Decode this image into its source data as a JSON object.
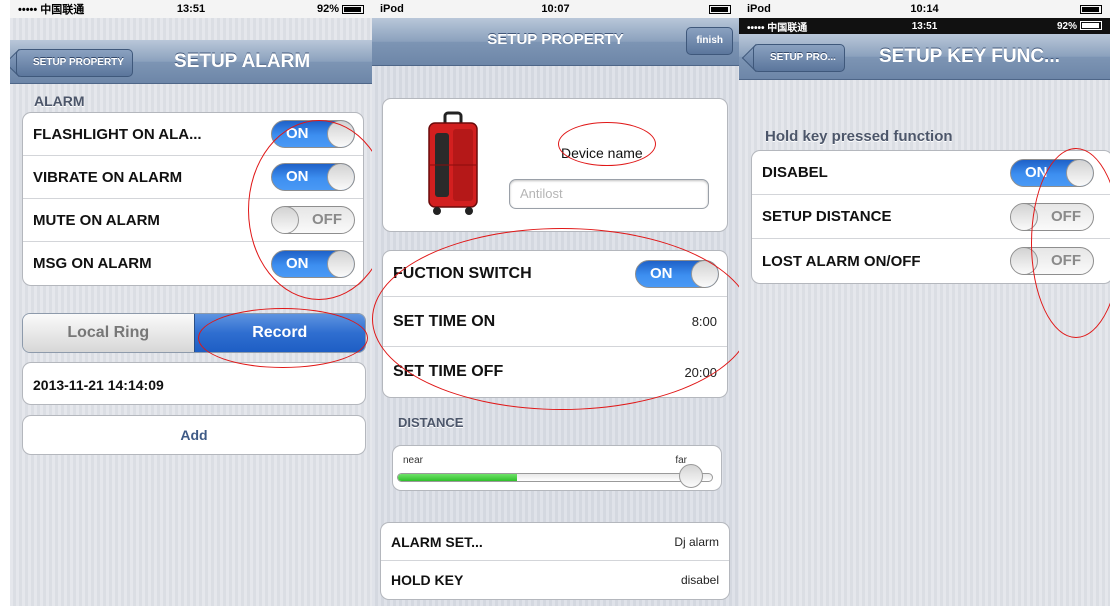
{
  "colors": {
    "toggle_on": "#3d8ff0",
    "annotation": "#e01717",
    "navbar": "#7d95b4",
    "slider_fill": "#2fc02b"
  },
  "screen1": {
    "status": {
      "carrier": "••••• 中国联通 ",
      "time": "13:51",
      "battery": "92%"
    },
    "back_label": "SETUP PROPERTY",
    "title": "SETUP ALARM",
    "section": "ALARM",
    "toggles": [
      {
        "label": "FLASHLIGHT ON ALA...",
        "state": "ON"
      },
      {
        "label": "VIBRATE ON ALARM",
        "state": "ON"
      },
      {
        "label": "MUTE ON ALARM",
        "state": "OFF"
      },
      {
        "label": "MSG ON ALARM",
        "state": "ON"
      }
    ],
    "segments": {
      "left": "Local Ring",
      "right": "Record",
      "selected": "Record"
    },
    "record_entry": "2013-11-21 14:14:09",
    "add_label": "Add"
  },
  "screen2": {
    "status": {
      "device": "iPod",
      "time": "10:07"
    },
    "title": "SETUP PROPERTY",
    "finish_label": "finish",
    "device_name_label": "Device name",
    "device_name_placeholder": "Antilost",
    "switch_row": {
      "label": "FUCTION SWITCH",
      "state": "ON"
    },
    "time_rows": [
      {
        "label": "SET TIME ON",
        "value": "8:00"
      },
      {
        "label": "SET TIME OFF",
        "value": "20:00"
      }
    ],
    "distance_section": "DISTANCE",
    "slider": {
      "min_label": "near",
      "max_label": "far",
      "fill_fraction": 0.38
    },
    "bottom_rows": [
      {
        "label": "ALARM SET...",
        "value": "Dj alarm"
      },
      {
        "label": "HOLD KEY",
        "value": "disabel"
      }
    ]
  },
  "screen3": {
    "outer_status": {
      "device": "iPod",
      "time": "10:14"
    },
    "status": {
      "carrier": "••••• 中国联通 ",
      "time": "13:51",
      "battery": "92%"
    },
    "back_label": "SETUP PRO...",
    "title": "SETUP KEY FUNC...",
    "section": "Hold key pressed function",
    "toggles": [
      {
        "label": "DISABEL",
        "state": "ON"
      },
      {
        "label": "SETUP DISTANCE",
        "state": "OFF"
      },
      {
        "label": "LOST ALARM ON/OFF",
        "state": "OFF"
      }
    ]
  }
}
